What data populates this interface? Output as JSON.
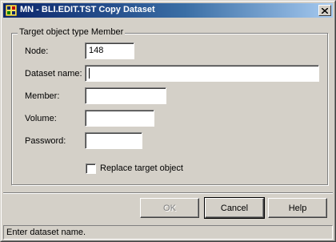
{
  "window": {
    "title": "MN - BLI.EDIT.TST Copy Dataset",
    "icon": "app-grid-icon"
  },
  "group": {
    "legend": "Target object type Member"
  },
  "fields": {
    "node": {
      "label": "Node:",
      "value": "148"
    },
    "dataset_name": {
      "label": "Dataset name:",
      "value": ""
    },
    "member": {
      "label": "Member:",
      "value": ""
    },
    "volume": {
      "label": "Volume:",
      "value": ""
    },
    "password": {
      "label": "Password:",
      "value": ""
    }
  },
  "options": {
    "replace_target": {
      "label": "Replace target object",
      "checked": false
    }
  },
  "buttons": {
    "ok": "OK",
    "cancel": "Cancel",
    "help": "Help"
  },
  "status": {
    "text": "Enter dataset name."
  },
  "colors": {
    "face": "#d4d0c8",
    "title_start": "#0a246a",
    "title_end": "#a6caf0"
  }
}
